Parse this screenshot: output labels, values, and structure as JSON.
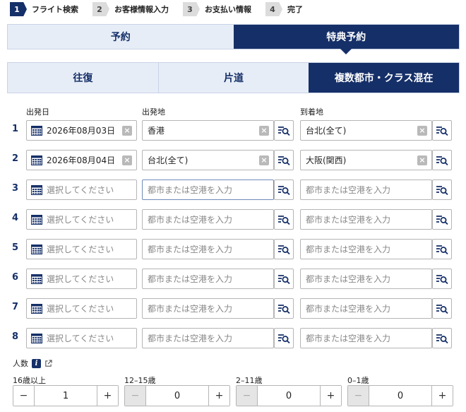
{
  "steps": [
    {
      "num": "1",
      "label": "フライト検索",
      "active": true
    },
    {
      "num": "2",
      "label": "お客様情報入力",
      "active": false
    },
    {
      "num": "3",
      "label": "お支払い情報",
      "active": false
    },
    {
      "num": "4",
      "label": "完了",
      "active": false
    }
  ],
  "booking_tabs": [
    {
      "label": "予約",
      "selected": false
    },
    {
      "label": "特典予約",
      "selected": true
    }
  ],
  "trip_tabs": [
    {
      "label": "往復",
      "selected": false
    },
    {
      "label": "片道",
      "selected": false
    },
    {
      "label": "複数都市・クラス混在",
      "selected": true
    }
  ],
  "columns": {
    "date": "出発日",
    "from": "出発地",
    "to": "到着地"
  },
  "date_placeholder": "選択してください",
  "city_placeholder": "都市または空港を入力",
  "segments": [
    {
      "num": "1",
      "date": "2026年08月03日",
      "from": "香港",
      "to": "台北(全て)"
    },
    {
      "num": "2",
      "date": "2026年08月04日",
      "from": "台北(全て)",
      "to": "大阪(関西)"
    },
    {
      "num": "3",
      "date": "",
      "from": "",
      "to": ""
    },
    {
      "num": "4",
      "date": "",
      "from": "",
      "to": ""
    },
    {
      "num": "5",
      "date": "",
      "from": "",
      "to": ""
    },
    {
      "num": "6",
      "date": "",
      "from": "",
      "to": ""
    },
    {
      "num": "7",
      "date": "",
      "from": "",
      "to": ""
    },
    {
      "num": "8",
      "date": "",
      "from": "",
      "to": ""
    }
  ],
  "passengers": {
    "title": "人数",
    "info_glyph": "i",
    "groups": [
      {
        "label": "16歳以上",
        "value": "1",
        "minus": "−",
        "plus": "+",
        "minus_disabled": false
      },
      {
        "label": "12–15歳",
        "value": "0",
        "minus": "−",
        "plus": "+",
        "minus_disabled": true
      },
      {
        "label": "2–11歳",
        "value": "0",
        "minus": "−",
        "plus": "+",
        "minus_disabled": true
      },
      {
        "label": "0–1歳",
        "value": "0",
        "minus": "−",
        "plus": "+",
        "minus_disabled": true
      }
    ]
  },
  "colors": {
    "navy": "#152f68",
    "tab_light": "#e7edf7"
  }
}
